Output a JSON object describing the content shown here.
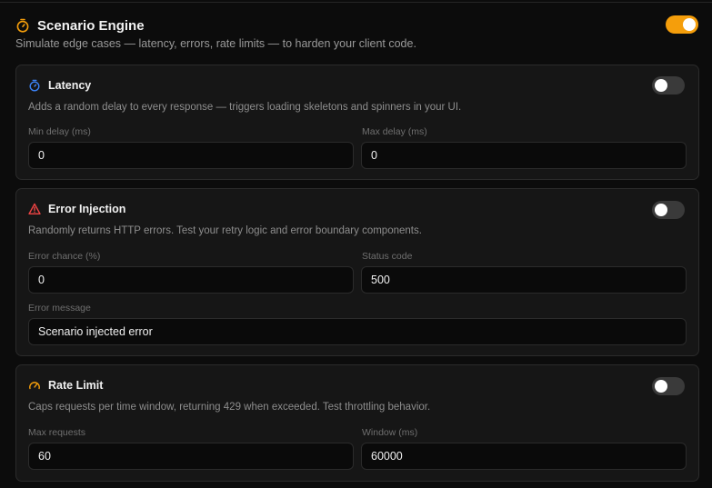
{
  "header": {
    "title": "Scenario Engine",
    "subtitle": "Simulate edge cases — latency, errors, rate limits — to harden your client code.",
    "enabled": true,
    "accent": "#f59e0b"
  },
  "latency": {
    "title": "Latency",
    "description": "Adds a random delay to every response — triggers loading skeletons and spinners in your UI.",
    "enabled": false,
    "min_label": "Min delay (ms)",
    "min_value": "0",
    "max_label": "Max delay (ms)",
    "max_value": "0",
    "icon": "stopwatch-icon",
    "icon_color": "#3b82f6"
  },
  "error_injection": {
    "title": "Error Injection",
    "description": "Randomly returns HTTP errors. Test your retry logic and error boundary components.",
    "enabled": false,
    "chance_label": "Error chance (%)",
    "chance_value": "0",
    "status_label": "Status code",
    "status_value": "500",
    "message_label": "Error message",
    "message_value": "Scenario injected error",
    "icon": "warning-icon",
    "icon_color": "#ef4444"
  },
  "rate_limit": {
    "title": "Rate Limit",
    "description": "Caps requests per time window, returning 429 when exceeded. Test throttling behavior.",
    "enabled": false,
    "max_label": "Max requests",
    "max_value": "60",
    "window_label": "Window (ms)",
    "window_value": "60000",
    "icon": "gauge-icon",
    "icon_color": "#f59e0b"
  }
}
